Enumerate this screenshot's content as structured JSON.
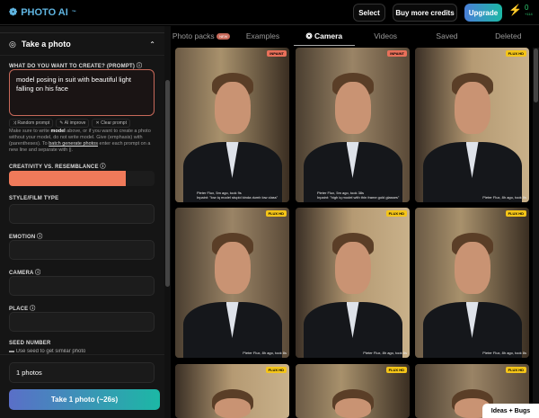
{
  "header": {
    "logo": "PHOTO AI",
    "logo_tm": "™",
    "select": "Select",
    "buy": "Buy more credits",
    "upgrade": "Upgrade",
    "credits": "0",
    "credits_sub": "+114"
  },
  "sidebar": {
    "title": "Take a photo",
    "prompt_label": "WHAT DO YOU WANT TO CREATE? (PROMPT)",
    "prompt_value": "model posing in suit with beautiful light falling on his face",
    "chips": [
      "Random prompt",
      "AI improve",
      "Clear prompt"
    ],
    "help": {
      "p1": "Make sure to write ",
      "model": "model",
      "p2": " above, or if you want to create a photo without your model, do not write model. Give (emphasis) with (parentheses). To ",
      "link": "batch generate photos",
      "p3": " enter each prompt on a new line and separate with ||."
    },
    "creativity_label": "CREATIVITY VS. RESEMBLANCE",
    "creativity_value": 0.8,
    "style_label": "STYLE/FILM TYPE",
    "emotion_label": "EMOTION",
    "camera_label": "CAMERA",
    "place_label": "PLACE",
    "seed_label": "SEED NUMBER",
    "seed_option": "Use seed to get similar photo",
    "count": "1 photos",
    "take": "Take 1 photo (~26s)"
  },
  "tabs": [
    {
      "label": "Photo packs",
      "badge": "NEW"
    },
    {
      "label": "Examples"
    },
    {
      "label": "Camera"
    },
    {
      "label": "Videos"
    },
    {
      "label": "Saved"
    },
    {
      "label": "Deleted"
    }
  ],
  "photos": [
    {
      "badge": "INPAINT",
      "meta": "Pieter Flux, 5m ago, took 9s",
      "sub": "Inpaint: \"low iq model stupid kinda dumb low class\""
    },
    {
      "badge": "INPAINT",
      "meta": "Pieter Flux, 5m ago, took 38s",
      "sub": "Inpaint: \"high iq model with thin frame gold glasses\""
    },
    {
      "badge": "FLUX HD",
      "meta": "Pieter Flux, 8h ago, took 8s"
    },
    {
      "badge": "FLUX HD",
      "meta": "Pieter Flux, 8h ago, took 8s"
    },
    {
      "badge": "FLUX HD",
      "meta": "Pieter Flux, 8h ago, took 8s"
    },
    {
      "badge": "FLUX HD",
      "meta": "Pieter Flux, 8h ago, took 8s"
    },
    {
      "badge": "FLUX HD"
    },
    {
      "badge": "FLUX HD"
    },
    {
      "badge": "FLUX HD"
    }
  ],
  "feedback": "Ideas + Bugs",
  "colors": {
    "accent": "#f07a5a",
    "inpaint": "#e8705a",
    "flux": "#f5c518"
  }
}
